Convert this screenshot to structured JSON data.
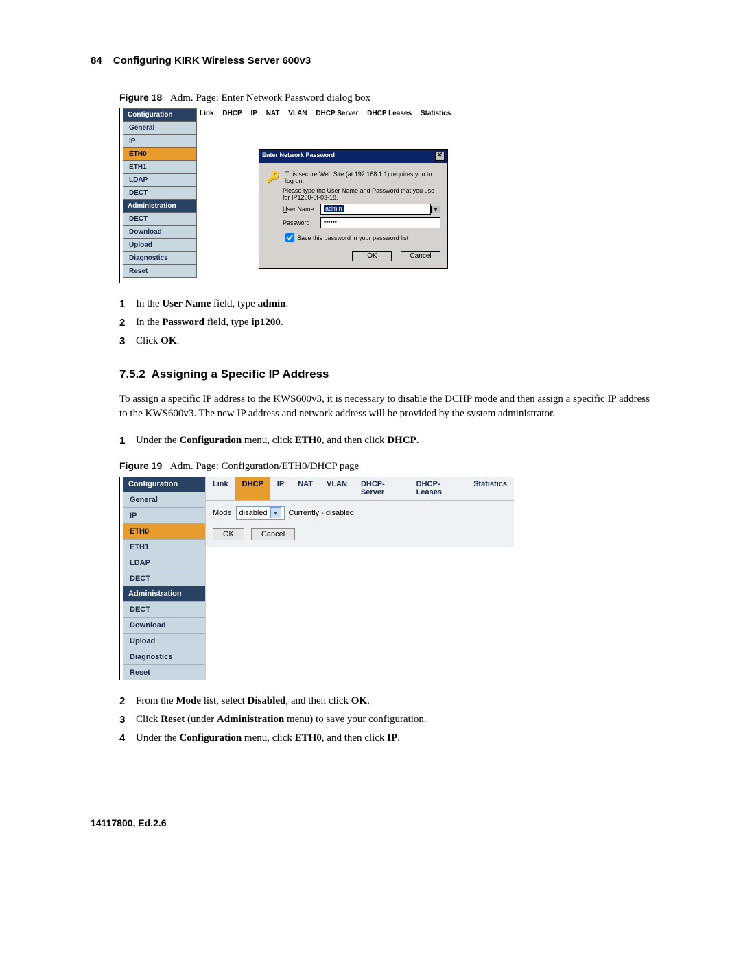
{
  "header": {
    "page_num": "84",
    "title": "Configuring KIRK Wireless Server 600v3"
  },
  "fig18": {
    "label": "Figure 18",
    "title": "Adm. Page: Enter Network Password dialog box",
    "sidebar_heads": [
      "Configuration",
      "Administration"
    ],
    "sidebar_cfg": [
      "General",
      "IP",
      "ETH0",
      "ETH1",
      "LDAP",
      "DECT"
    ],
    "sidebar_adm": [
      "DECT",
      "Download",
      "Upload",
      "Diagnostics",
      "Reset"
    ],
    "tabs": [
      "Link",
      "DHCP",
      "IP",
      "NAT",
      "VLAN",
      "DHCP Server",
      "DHCP Leases",
      "Statistics"
    ],
    "dialog": {
      "title": "Enter Network Password",
      "msg1": "This secure Web Site (at 192.168.1.1) requires you to log on.",
      "msg2": "Please type the User Name and Password that you use for IP1200-0f-03-18.",
      "user_label": "User Name",
      "user_value": "admin",
      "pass_label": "Password",
      "pass_value": "••••••",
      "save_label": "Save this password in your password list",
      "ok": "OK",
      "cancel": "Cancel"
    }
  },
  "steps_a": [
    {
      "num": "1",
      "html": "In the <b>User Name</b> field, type <b>admin</b>."
    },
    {
      "num": "2",
      "html": "In the <b>Password</b> field, type <b>ip1200</b>."
    },
    {
      "num": "3",
      "html": "Click <b>OK</b>."
    }
  ],
  "section": {
    "num": "7.5.2",
    "title": "Assigning a Specific IP Address"
  },
  "para1": "To assign a specific IP address to the KWS600v3, it is necessary to disable the DCHP mode and then assign a specific IP address to the KWS600v3. The new IP address and network address will be provided by the system administrator.",
  "step_pre19": {
    "num": "1",
    "html": "Under the <b>Configuration</b> menu, click <b>ETH0</b>, and then click <b>DHCP</b>."
  },
  "fig19": {
    "label": "Figure 19",
    "title": "Adm. Page: Configuration/ETH0/DHCP page",
    "sidebar_heads": [
      "Configuration",
      "Administration"
    ],
    "sidebar_cfg": [
      "General",
      "IP",
      "ETH0",
      "ETH1",
      "LDAP",
      "DECT"
    ],
    "sidebar_adm": [
      "DECT",
      "Download",
      "Upload",
      "Diagnostics",
      "Reset"
    ],
    "tabs": [
      "Link",
      "DHCP",
      "IP",
      "NAT",
      "VLAN",
      "DHCP-Server",
      "DHCP-Leases",
      "Statistics"
    ],
    "mode_label": "Mode",
    "mode_value": "disabled",
    "mode_status": "Currently - disabled",
    "ok": "OK",
    "cancel": "Cancel"
  },
  "steps_b": [
    {
      "num": "2",
      "html": "From the <b>Mode</b> list, select <b>Disabled</b>, and then click <b>OK</b>."
    },
    {
      "num": "3",
      "html": "Click <b>Reset</b> (under <b>Administration</b> menu) to save your configuration."
    },
    {
      "num": "4",
      "html": "Under the <b>Configuration</b> menu, click <b>ETH0</b>, and then click <b>IP</b>."
    }
  ],
  "footer": "14117800, Ed.2.6"
}
